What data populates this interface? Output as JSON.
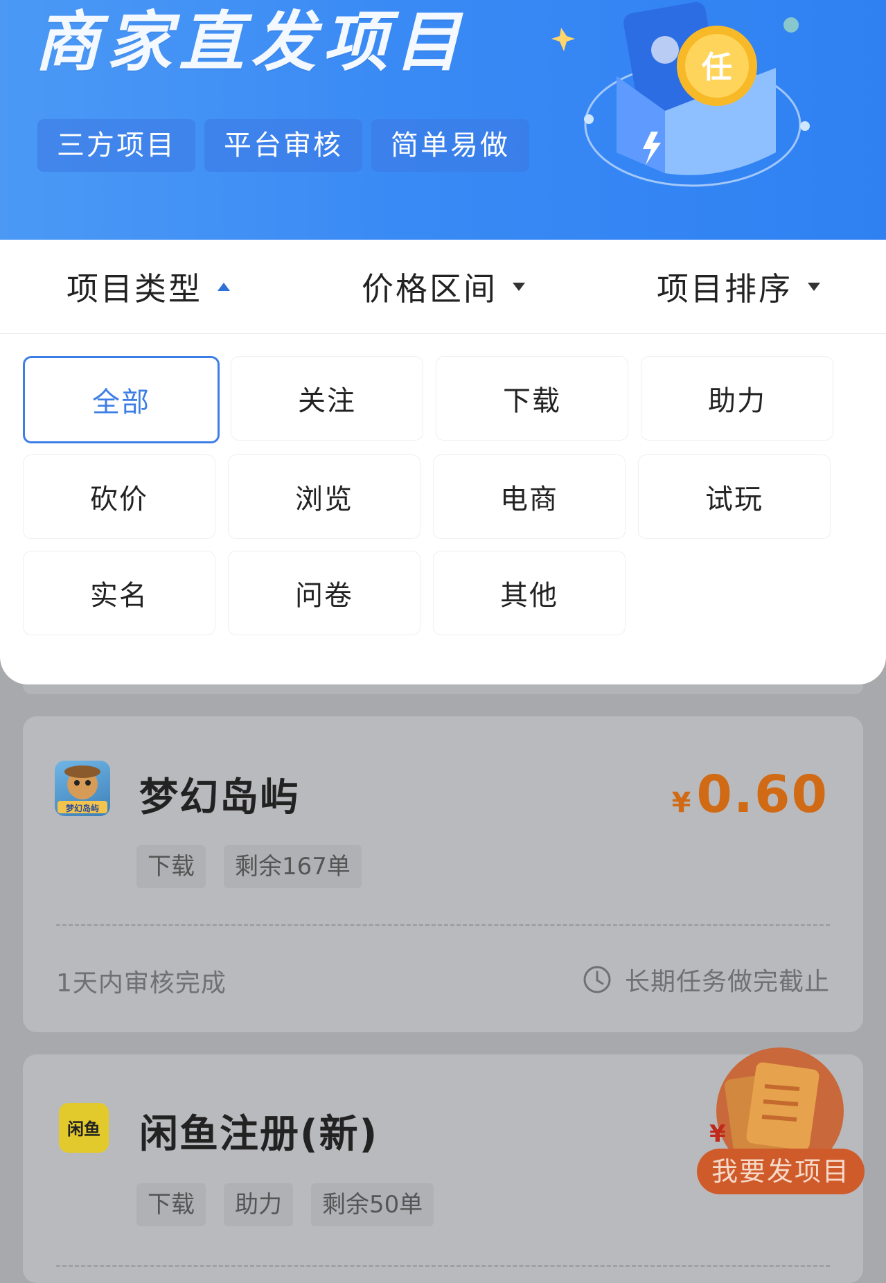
{
  "hero": {
    "title": "商家直发项目",
    "tags": [
      "三方项目",
      "平台审核",
      "简单易做"
    ],
    "colors": {
      "bg_start": "#4b99f5",
      "bg_end": "#2f81f2"
    }
  },
  "filters": {
    "type_label": "项目类型",
    "price_label": "价格区间",
    "sort_label": "项目排序"
  },
  "categories": {
    "items": [
      "全部",
      "关注",
      "下载",
      "助力",
      "砍价",
      "浏览",
      "电商",
      "试玩",
      "实名",
      "问卷",
      "其他"
    ],
    "selected": "全部",
    "accent": "#3d7ee6"
  },
  "listings": [
    {
      "name": "梦幻岛屿",
      "currency": "¥",
      "price": "0.60",
      "tags": [
        "下载",
        "剩余167单"
      ],
      "review_note": "1天内审核完成",
      "deadline": "长期任务做完截止",
      "icon": "game-app-icon",
      "icon_text": "梦幻岛屿"
    },
    {
      "name": "闲鱼注册(新)",
      "tags": [
        "下载",
        "助力",
        "剩余50单"
      ],
      "icon": "xianyu-app-icon",
      "icon_text": "闲鱼"
    }
  ],
  "fab": {
    "label": "我要发项目",
    "icon": "publish-project-icon"
  }
}
